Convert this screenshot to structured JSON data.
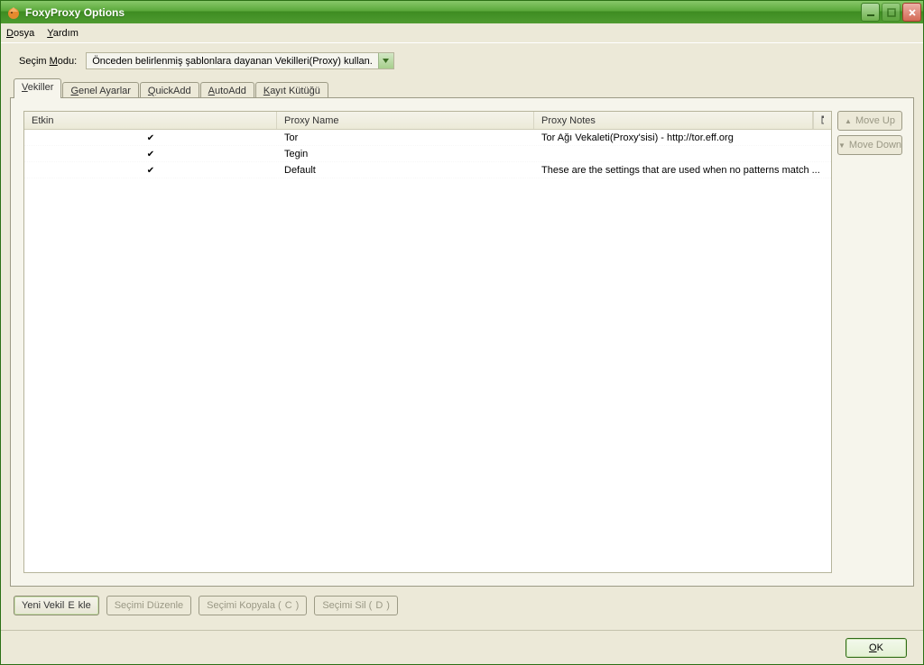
{
  "titlebar": {
    "title": "FoxyProxy Options"
  },
  "menubar": {
    "file_pre": "D",
    "file_rest": "osya",
    "help_pre": "Y",
    "help_rest": "ardım"
  },
  "mode": {
    "label_pre": "Seçim ",
    "label_ul": "M",
    "label_rest": "odu:",
    "value": "Önceden belirlenmiş şablonlara dayanan Vekilleri(Proxy) kullan."
  },
  "tabs": {
    "t0_pre": "V",
    "t0_rest": "ekiller",
    "t1_pre": "G",
    "t1_rest": "enel Ayarlar",
    "t2_pre": "Q",
    "t2_rest": "uickAdd",
    "t3_pre": "A",
    "t3_rest": "utoAdd",
    "t4_pre": "K",
    "t4_rest": "ayıt Kütüğü"
  },
  "grid": {
    "headers": {
      "etkin": "Etkin",
      "name": "Proxy Name",
      "notes": "Proxy Notes"
    },
    "rows": [
      {
        "enabled": true,
        "name": "Tor",
        "notes": "Tor Ağı Vekaleti(Proxy'sisi) - http://tor.eff.org"
      },
      {
        "enabled": true,
        "name": "Tegin",
        "notes": ""
      },
      {
        "enabled": true,
        "name": "Default",
        "notes": "These are the settings that are used when no patterns match ..."
      }
    ]
  },
  "side": {
    "moveup_pre": "M",
    "moveup_rest": "ove Up",
    "movedown_pre": "M",
    "movedown_rest": "ove Down"
  },
  "bottom": {
    "add_pre": "Yeni Vekil ",
    "add_ul": "E",
    "add_rest": "kle",
    "edit": "Seçimi Düzenle",
    "copy_pre": "Seçimi Kopyala (",
    "copy_ul": "C",
    "copy_rest": ")",
    "del_pre": "Seçimi Sil (",
    "del_ul": "D",
    "del_rest": ")"
  },
  "footer": {
    "ok_ul": "O",
    "ok_rest": "K"
  }
}
